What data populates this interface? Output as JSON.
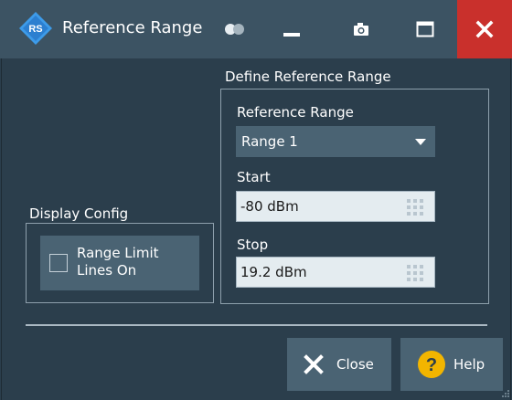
{
  "window": {
    "title": "Reference Range",
    "controls": [
      "toggle-icon",
      "minimize-icon",
      "camera-icon",
      "maximize-icon",
      "close-icon"
    ],
    "close_color": "#c9302c"
  },
  "display_config": {
    "group_label": "Display Config",
    "range_limit_lines": {
      "label_line1": "Range Limit",
      "label_line2": "Lines On",
      "checked": false
    }
  },
  "define_reference_range": {
    "group_label": "Define Reference Range",
    "reference_range": {
      "label": "Reference Range",
      "selected": "Range 1"
    },
    "start": {
      "label": "Start",
      "value": "-80 dBm"
    },
    "stop": {
      "label": "Stop",
      "value": "19.2 dBm"
    }
  },
  "buttons": {
    "close_label": "Close",
    "help_label": "Help"
  },
  "colors": {
    "background": "#2b3e4c",
    "titlebar": "#3c5363",
    "control": "#4a6373",
    "field": "#e4ecf0",
    "help_icon": "#f2b500"
  }
}
